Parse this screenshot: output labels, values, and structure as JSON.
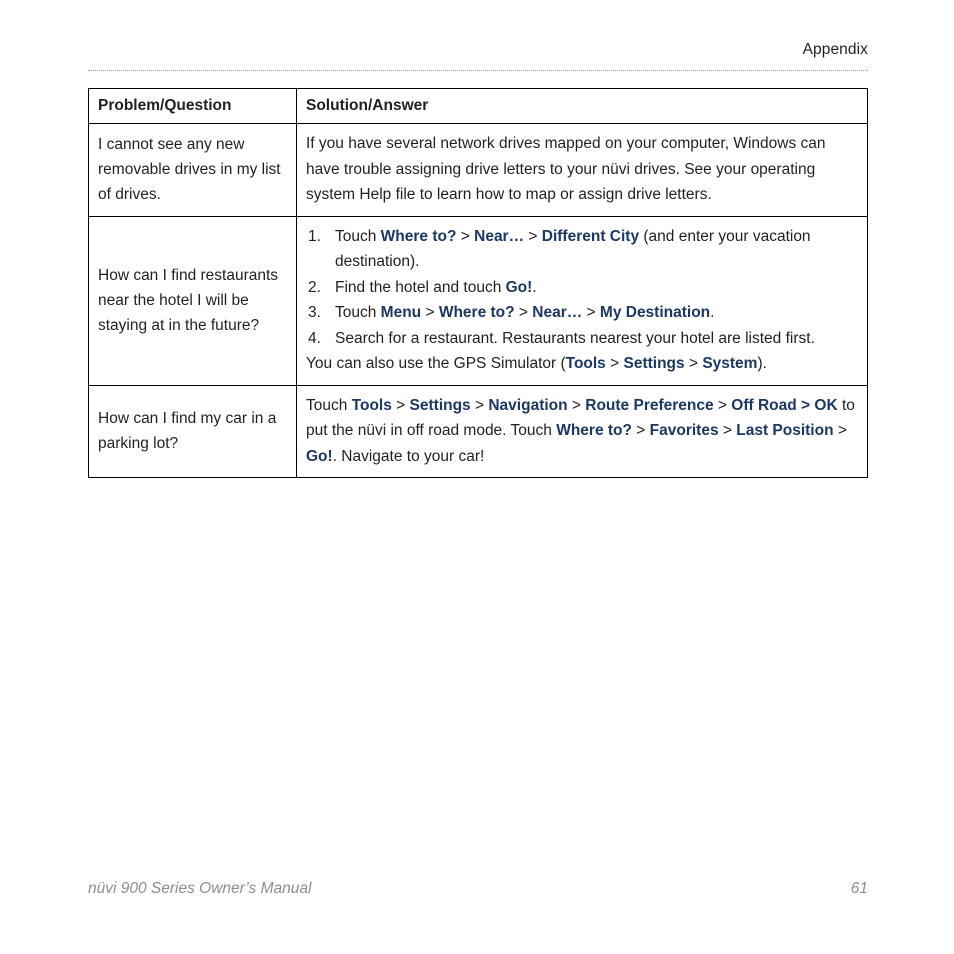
{
  "page": {
    "running_head": "Appendix",
    "footer_title": "nüvi 900 Series Owner’s Manual",
    "footer_page": "61",
    "accent_color": "#1b3864",
    "text_color": "#231f20",
    "footer_color": "#8d8d8d"
  },
  "table": {
    "headers": {
      "question": "Problem/Question",
      "answer": "Solution/Answer"
    },
    "rows": [
      {
        "question": "I cannot see any new removable drives in my list of drives.",
        "answer_text": "If you have several network drives mapped on your computer, Windows can have trouble assigning drive letters to your nüvi drives. See your operating system Help file to learn how to map or assign drive letters."
      },
      {
        "question": "How can I find restaurants near the hotel I will be staying at in the future?",
        "steps": [
          {
            "lead": "Touch ",
            "terms": [
              "Where to?",
              "Near…",
              "Different City"
            ],
            "tail": " (and enter your vacation destination)."
          },
          {
            "lead": "Find the hotel and touch ",
            "terms": [
              "Go!"
            ],
            "tail": "."
          },
          {
            "lead": "Touch ",
            "terms": [
              "Menu",
              "Where to?",
              "Near…",
              "My Destination"
            ],
            "tail": "."
          },
          {
            "lead": "Search for a restaurant. Restaurants nearest your hotel are listed first.",
            "terms": [],
            "tail": ""
          }
        ],
        "closing": {
          "lead": "You can also use the GPS Simulator (",
          "terms": [
            "Tools",
            "Settings",
            "System"
          ],
          "tail": ")."
        }
      },
      {
        "question": "How can I find my car in a parking lot?",
        "answer_parts": {
          "lead": "Touch ",
          "path1": [
            "Tools",
            "Settings",
            "Navigation",
            "Route Preference",
            "Off Road"
          ],
          "bold_sep_term": "OK",
          "mid": " to put the nüvi in off road mode. Touch ",
          "path2": [
            "Where to?",
            "Favorites",
            "Last Position",
            "Go!"
          ],
          "tail": ". Navigate to your car!"
        }
      }
    ],
    "separator": ">"
  }
}
